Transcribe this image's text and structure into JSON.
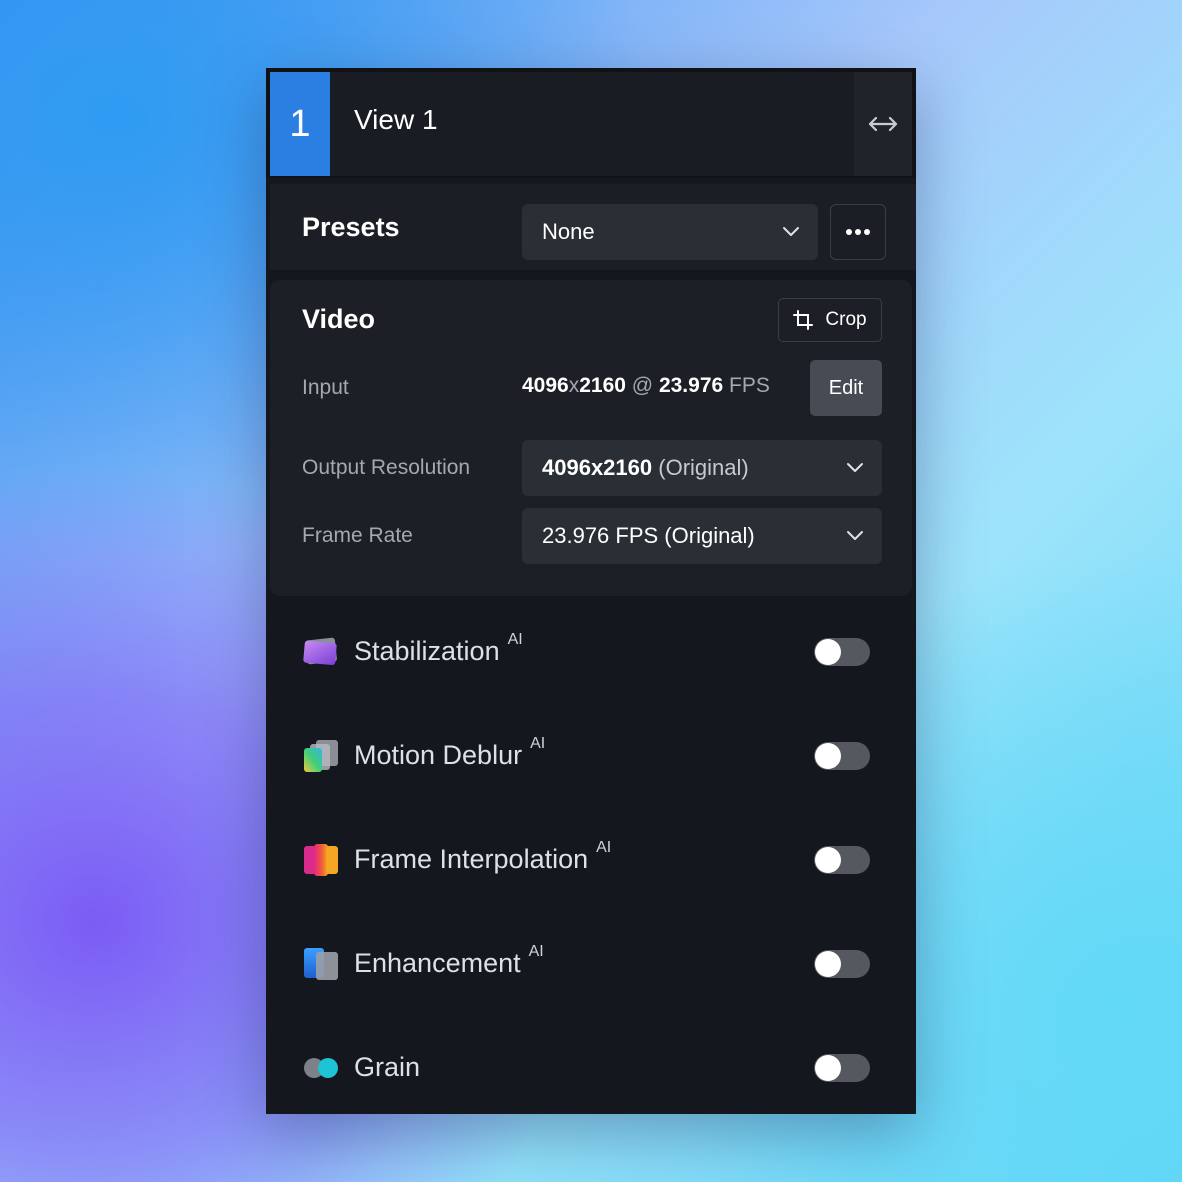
{
  "header": {
    "view_number": "1",
    "view_title": "View 1",
    "expand_icon": "horizontal-expand-icon"
  },
  "presets": {
    "label": "Presets",
    "selected": "None",
    "more_icon": "more-horizontal-icon"
  },
  "video": {
    "title": "Video",
    "crop_label": "Crop",
    "input_label": "Input",
    "input_width": "4096",
    "input_x": "x",
    "input_height": "2160",
    "input_at": "@",
    "input_fps": "23.976",
    "input_fps_unit": "FPS",
    "edit_label": "Edit",
    "output_resolution_label": "Output Resolution",
    "output_resolution_value": "4096x2160",
    "output_resolution_suffix": "(Original)",
    "frame_rate_label": "Frame Rate",
    "frame_rate_value": "23.976 FPS (Original)"
  },
  "features": [
    {
      "name": "Stabilization",
      "badge": "AI",
      "enabled": false,
      "icon": "stabilization-icon"
    },
    {
      "name": "Motion Deblur",
      "badge": "AI",
      "enabled": false,
      "icon": "motion-deblur-icon"
    },
    {
      "name": "Frame Interpolation",
      "badge": "AI",
      "enabled": false,
      "icon": "frame-interpolation-icon"
    },
    {
      "name": "Enhancement",
      "badge": "AI",
      "enabled": false,
      "icon": "enhancement-icon"
    },
    {
      "name": "Grain",
      "badge": "",
      "enabled": false,
      "icon": "grain-icon"
    }
  ],
  "colors": {
    "accent": "#2b7fe3",
    "panel": "#14171d",
    "toggle_off": "#55595f"
  }
}
